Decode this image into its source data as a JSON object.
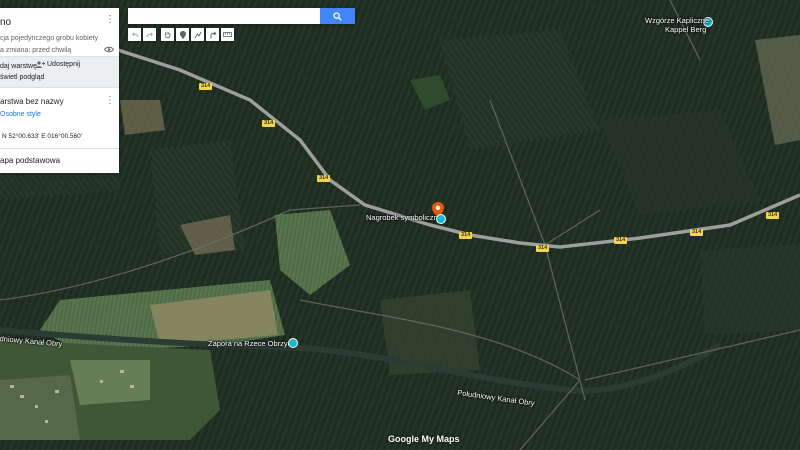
{
  "panel": {
    "title": "no",
    "description": "cja pojedynczego grobu kobiety",
    "last_change": "a zmiana: przed chwilą",
    "add_layer": "daj warstwę",
    "share": "Udostępnij",
    "preview": "świetl podgląd",
    "layer_name": "arstwa bez nazwy",
    "layer_style": "Osobne style",
    "coordinates": "N 52°00.633' E 016°00.560'",
    "basemap": "apa podstawowa"
  },
  "search": {
    "value": "",
    "placeholder": ""
  },
  "map": {
    "labels": {
      "chapel_line1": "Wzgórze Kapliczne -",
      "chapel_line2": "Kappel Berg",
      "grave": "Nagrobek symboliczny",
      "dam": "Zapora na Rzece Obrzycy",
      "canal_south": "Południowy Kanał Obry",
      "canal_west": "dniowy Kanał Obry"
    },
    "road_number": "314",
    "logo": "Google My Maps"
  },
  "colors": {
    "accent": "#4285f4",
    "marker": "#e8590c",
    "poi": "#1ab7d0",
    "road": "#9e9e9e",
    "road_sign": "#f3d547"
  }
}
